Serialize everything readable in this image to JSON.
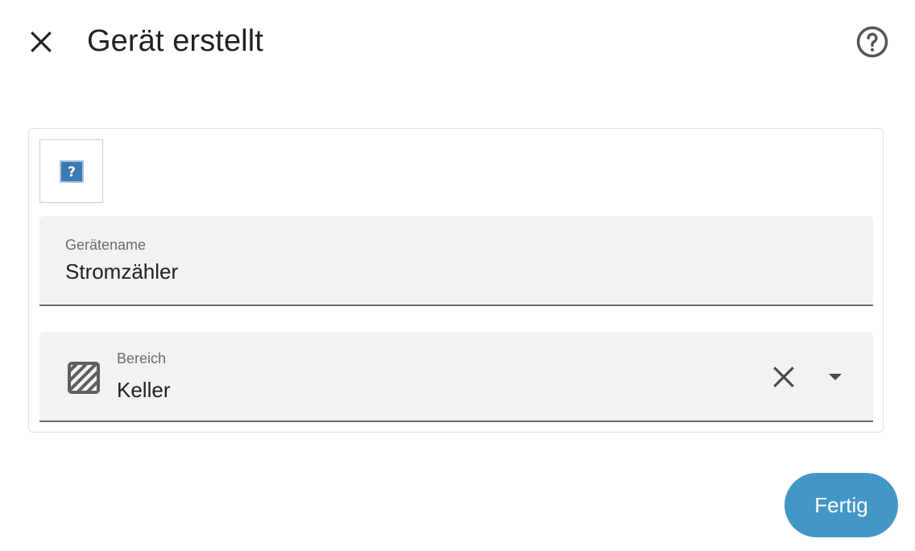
{
  "dialog": {
    "title": "Gerät erstellt",
    "close_icon": "close-icon",
    "help_icon": "help-circle-icon"
  },
  "picture": {
    "icon": "broken-image-icon",
    "glyph": "?"
  },
  "name_field": {
    "label": "Gerätename",
    "value": "Stromzähler"
  },
  "area_field": {
    "label": "Bereich",
    "value": "Keller",
    "icon": "area-icon",
    "clear_icon": "clear-icon",
    "dropdown_icon": "dropdown-arrow-icon"
  },
  "actions": {
    "done_label": "Fertig"
  },
  "colors": {
    "accent": "#4297c7",
    "field_bg": "#f2f2f2",
    "text": "#212121",
    "muted": "#6b6b6b"
  }
}
